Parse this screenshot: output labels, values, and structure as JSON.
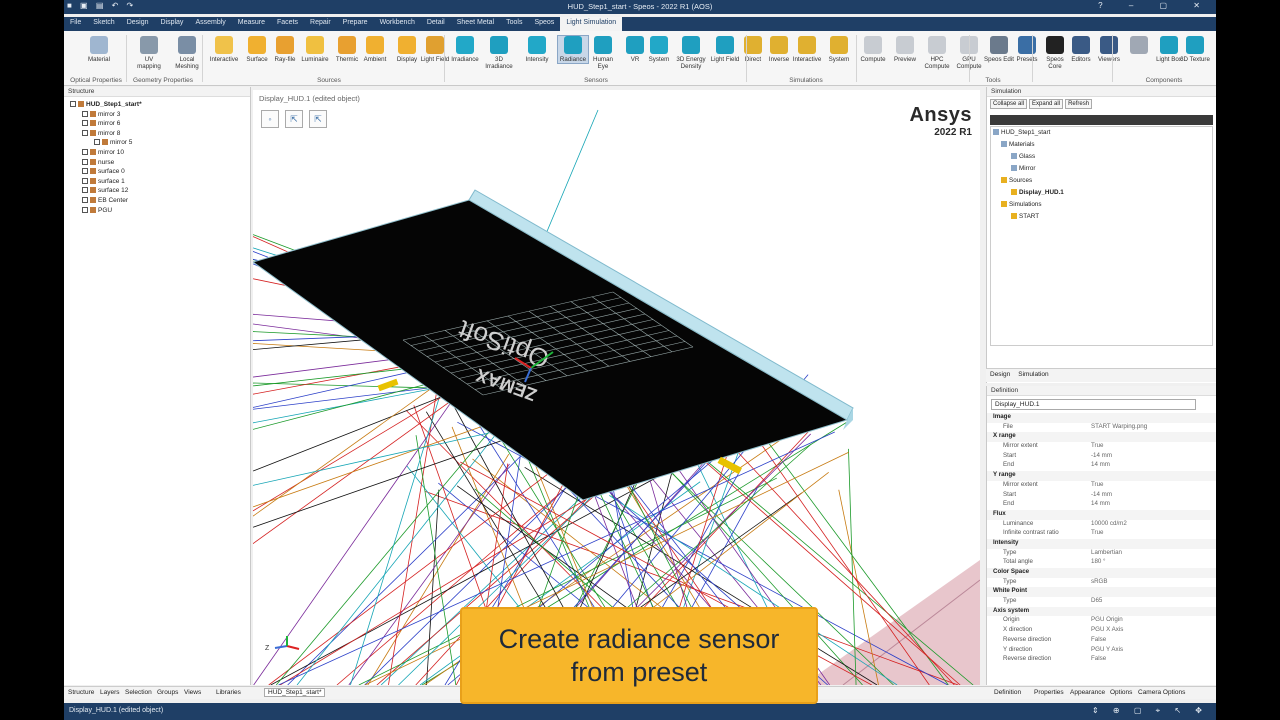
{
  "titlebar": {
    "title": "HUD_Step1_start - Speos - 2022 R1 (AOS)"
  },
  "menu_tabs": [
    "File",
    "Sketch",
    "Design",
    "Display",
    "Assembly",
    "Measure",
    "Facets",
    "Repair",
    "Prepare",
    "Workbench",
    "Detail",
    "Sheet Metal",
    "Tools",
    "Speos",
    "Light Simulation"
  ],
  "ribbon": {
    "buttons": [
      {
        "label": "Material",
        "color": "#9fb6d0"
      },
      {
        "label": "UV mapping",
        "color": "#8899aa"
      },
      {
        "label": "Local Meshing",
        "color": "#7a8ea5"
      },
      {
        "label": "Interactive",
        "color": "#f0c24a"
      },
      {
        "label": "Surface",
        "color": "#f0b030"
      },
      {
        "label": "Ray-file",
        "color": "#e8a030"
      },
      {
        "label": "Luminaire",
        "color": "#f0c040"
      },
      {
        "label": "Thermic",
        "color": "#e8a030"
      },
      {
        "label": "Ambient",
        "color": "#f0b030"
      },
      {
        "label": "Display",
        "color": "#f0b030"
      },
      {
        "label": "Light Field",
        "color": "#e0a030"
      },
      {
        "label": "Irradiance",
        "color": "#22a8c8"
      },
      {
        "label": "3D Irradiance",
        "color": "#1f9fc0"
      },
      {
        "label": "Intensity",
        "color": "#22a8c8"
      },
      {
        "label": "Radiance",
        "color": "#1f9fc0"
      },
      {
        "label": "Human Eye",
        "color": "#1f9fc0"
      },
      {
        "label": "VR",
        "color": "#1f9fc0"
      },
      {
        "label": "System",
        "color": "#22a8c8"
      },
      {
        "label": "3D Energy Density",
        "color": "#1f9fc0"
      },
      {
        "label": "Light Field",
        "color": "#1f9fc0"
      },
      {
        "label": "Direct",
        "color": "#e0b030"
      },
      {
        "label": "Inverse",
        "color": "#e0b030"
      },
      {
        "label": "Interactive",
        "color": "#e0b030"
      },
      {
        "label": "System",
        "color": "#e0b030"
      },
      {
        "label": "Compute",
        "color": "#c8ccd2"
      },
      {
        "label": "Preview",
        "color": "#c8ccd2"
      },
      {
        "label": "HPC Compute",
        "color": "#c8ccd2"
      },
      {
        "label": "GPU Compute",
        "color": "#c8ccd2"
      },
      {
        "label": "Speos Edit",
        "color": "#6b7a8c"
      },
      {
        "label": "Presets",
        "color": "#3a6ea5"
      },
      {
        "label": "Speos Core",
        "color": "#222222"
      },
      {
        "label": "Editors",
        "color": "#3a5a85"
      },
      {
        "label": "Viewers",
        "color": "#3a5a85"
      },
      {
        "label": "",
        "color": "#a0a8b4"
      },
      {
        "label": "Light Box",
        "color": "#1f9fc0"
      },
      {
        "label": "3D Texture",
        "color": "#1f9fc0"
      }
    ],
    "groups": [
      "Optical Properties",
      "Geometry Properties",
      "Sources",
      "Sensors",
      "Simulations",
      "Tools",
      "Components"
    ]
  },
  "structure": {
    "header": "Structure",
    "items": [
      "HUD_Step1_start*",
      "mirror 3",
      "mirror 6",
      "mirror 8",
      "mirror 5",
      "mirror 10",
      "nurse",
      "surface 0",
      "surface 1",
      "surface 12",
      "EB Center",
      "PGU"
    ]
  },
  "viewport": {
    "label": "Display_HUD.1 (edited object)",
    "tools": [
      "ellipse-select",
      "arrow-pick",
      "arrow-pick-2"
    ]
  },
  "brand": {
    "name": "Ansys",
    "release": "2022 R1"
  },
  "simulation_panel": {
    "header": "Simulation",
    "buttons": [
      "Collapse all",
      "Expand all",
      "Refresh"
    ],
    "tree": [
      "HUD_Step1_start",
      "Materials",
      "Glass",
      "Mirror",
      "Sources",
      "Display_HUD.1",
      "Simulations",
      "START"
    ],
    "tabs": [
      "Design",
      "Simulation"
    ]
  },
  "definition_panel": {
    "header": "Definition",
    "name": "Display_HUD.1",
    "rows": [
      {
        "k": "Image",
        "v": "",
        "g": true
      },
      {
        "k": "File",
        "v": "START Warping.png"
      },
      {
        "k": "X range",
        "v": "",
        "g": true
      },
      {
        "k": "Mirror extent",
        "v": "True"
      },
      {
        "k": "Start",
        "v": "-14 mm"
      },
      {
        "k": "End",
        "v": "14 mm"
      },
      {
        "k": "Y range",
        "v": "",
        "g": true
      },
      {
        "k": "Mirror extent",
        "v": "True"
      },
      {
        "k": "Start",
        "v": "-14 mm"
      },
      {
        "k": "End",
        "v": "14 mm"
      },
      {
        "k": "Flux",
        "v": "",
        "g": true
      },
      {
        "k": "Luminance",
        "v": "10000 cd/m2"
      },
      {
        "k": "Infinite contrast ratio",
        "v": "True"
      },
      {
        "k": "Intensity",
        "v": "",
        "g": true
      },
      {
        "k": "Type",
        "v": "Lambertian"
      },
      {
        "k": "Total angle",
        "v": "180 °"
      },
      {
        "k": "Color Space",
        "v": "",
        "g": true
      },
      {
        "k": "Type",
        "v": "sRGB"
      },
      {
        "k": "White Point",
        "v": "",
        "g": true
      },
      {
        "k": "Type",
        "v": "D65"
      },
      {
        "k": "Axis system",
        "v": "",
        "g": true
      },
      {
        "k": "Origin",
        "v": "PGU Origin"
      },
      {
        "k": "X direction",
        "v": "PGU X Axis"
      },
      {
        "k": "Reverse direction",
        "v": "False"
      },
      {
        "k": "Y direction",
        "v": "PGU Y Axis"
      },
      {
        "k": "Reverse direction",
        "v": "False"
      }
    ],
    "tabs": [
      "Definition",
      "Properties",
      "Appearance",
      "Options",
      "Camera Options"
    ]
  },
  "bottom_tabs": [
    "Structure",
    "Layers",
    "Selection",
    "Groups",
    "Views",
    "Libraries"
  ],
  "document_tab": "HUD_Step1_start*",
  "status": {
    "text": "Display_HUD.1 (edited object)"
  },
  "caption": {
    "line1": "Create radiance sensor",
    "line2": "from preset"
  },
  "colors": {
    "title_bar": "#1f3f66",
    "caption_bg": "#f7b62a",
    "accent": "#3a6ea5"
  }
}
